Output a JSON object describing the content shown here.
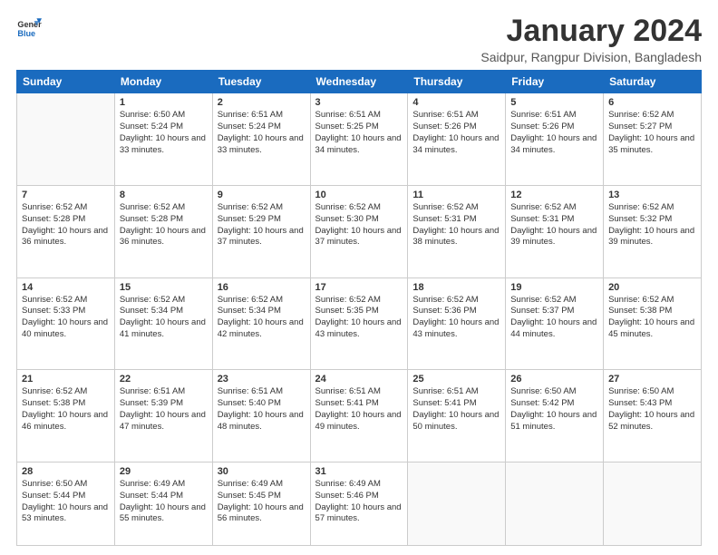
{
  "header": {
    "logo": "GeneralBlue",
    "month": "January 2024",
    "location": "Saidpur, Rangpur Division, Bangladesh"
  },
  "weekdays": [
    "Sunday",
    "Monday",
    "Tuesday",
    "Wednesday",
    "Thursday",
    "Friday",
    "Saturday"
  ],
  "weeks": [
    [
      {
        "day": "",
        "sunrise": "",
        "sunset": "",
        "daylight": ""
      },
      {
        "day": "1",
        "sunrise": "Sunrise: 6:50 AM",
        "sunset": "Sunset: 5:24 PM",
        "daylight": "Daylight: 10 hours and 33 minutes."
      },
      {
        "day": "2",
        "sunrise": "Sunrise: 6:51 AM",
        "sunset": "Sunset: 5:24 PM",
        "daylight": "Daylight: 10 hours and 33 minutes."
      },
      {
        "day": "3",
        "sunrise": "Sunrise: 6:51 AM",
        "sunset": "Sunset: 5:25 PM",
        "daylight": "Daylight: 10 hours and 34 minutes."
      },
      {
        "day": "4",
        "sunrise": "Sunrise: 6:51 AM",
        "sunset": "Sunset: 5:26 PM",
        "daylight": "Daylight: 10 hours and 34 minutes."
      },
      {
        "day": "5",
        "sunrise": "Sunrise: 6:51 AM",
        "sunset": "Sunset: 5:26 PM",
        "daylight": "Daylight: 10 hours and 34 minutes."
      },
      {
        "day": "6",
        "sunrise": "Sunrise: 6:52 AM",
        "sunset": "Sunset: 5:27 PM",
        "daylight": "Daylight: 10 hours and 35 minutes."
      }
    ],
    [
      {
        "day": "7",
        "sunrise": "Sunrise: 6:52 AM",
        "sunset": "Sunset: 5:28 PM",
        "daylight": "Daylight: 10 hours and 36 minutes."
      },
      {
        "day": "8",
        "sunrise": "Sunrise: 6:52 AM",
        "sunset": "Sunset: 5:28 PM",
        "daylight": "Daylight: 10 hours and 36 minutes."
      },
      {
        "day": "9",
        "sunrise": "Sunrise: 6:52 AM",
        "sunset": "Sunset: 5:29 PM",
        "daylight": "Daylight: 10 hours and 37 minutes."
      },
      {
        "day": "10",
        "sunrise": "Sunrise: 6:52 AM",
        "sunset": "Sunset: 5:30 PM",
        "daylight": "Daylight: 10 hours and 37 minutes."
      },
      {
        "day": "11",
        "sunrise": "Sunrise: 6:52 AM",
        "sunset": "Sunset: 5:31 PM",
        "daylight": "Daylight: 10 hours and 38 minutes."
      },
      {
        "day": "12",
        "sunrise": "Sunrise: 6:52 AM",
        "sunset": "Sunset: 5:31 PM",
        "daylight": "Daylight: 10 hours and 39 minutes."
      },
      {
        "day": "13",
        "sunrise": "Sunrise: 6:52 AM",
        "sunset": "Sunset: 5:32 PM",
        "daylight": "Daylight: 10 hours and 39 minutes."
      }
    ],
    [
      {
        "day": "14",
        "sunrise": "Sunrise: 6:52 AM",
        "sunset": "Sunset: 5:33 PM",
        "daylight": "Daylight: 10 hours and 40 minutes."
      },
      {
        "day": "15",
        "sunrise": "Sunrise: 6:52 AM",
        "sunset": "Sunset: 5:34 PM",
        "daylight": "Daylight: 10 hours and 41 minutes."
      },
      {
        "day": "16",
        "sunrise": "Sunrise: 6:52 AM",
        "sunset": "Sunset: 5:34 PM",
        "daylight": "Daylight: 10 hours and 42 minutes."
      },
      {
        "day": "17",
        "sunrise": "Sunrise: 6:52 AM",
        "sunset": "Sunset: 5:35 PM",
        "daylight": "Daylight: 10 hours and 43 minutes."
      },
      {
        "day": "18",
        "sunrise": "Sunrise: 6:52 AM",
        "sunset": "Sunset: 5:36 PM",
        "daylight": "Daylight: 10 hours and 43 minutes."
      },
      {
        "day": "19",
        "sunrise": "Sunrise: 6:52 AM",
        "sunset": "Sunset: 5:37 PM",
        "daylight": "Daylight: 10 hours and 44 minutes."
      },
      {
        "day": "20",
        "sunrise": "Sunrise: 6:52 AM",
        "sunset": "Sunset: 5:38 PM",
        "daylight": "Daylight: 10 hours and 45 minutes."
      }
    ],
    [
      {
        "day": "21",
        "sunrise": "Sunrise: 6:52 AM",
        "sunset": "Sunset: 5:38 PM",
        "daylight": "Daylight: 10 hours and 46 minutes."
      },
      {
        "day": "22",
        "sunrise": "Sunrise: 6:51 AM",
        "sunset": "Sunset: 5:39 PM",
        "daylight": "Daylight: 10 hours and 47 minutes."
      },
      {
        "day": "23",
        "sunrise": "Sunrise: 6:51 AM",
        "sunset": "Sunset: 5:40 PM",
        "daylight": "Daylight: 10 hours and 48 minutes."
      },
      {
        "day": "24",
        "sunrise": "Sunrise: 6:51 AM",
        "sunset": "Sunset: 5:41 PM",
        "daylight": "Daylight: 10 hours and 49 minutes."
      },
      {
        "day": "25",
        "sunrise": "Sunrise: 6:51 AM",
        "sunset": "Sunset: 5:41 PM",
        "daylight": "Daylight: 10 hours and 50 minutes."
      },
      {
        "day": "26",
        "sunrise": "Sunrise: 6:50 AM",
        "sunset": "Sunset: 5:42 PM",
        "daylight": "Daylight: 10 hours and 51 minutes."
      },
      {
        "day": "27",
        "sunrise": "Sunrise: 6:50 AM",
        "sunset": "Sunset: 5:43 PM",
        "daylight": "Daylight: 10 hours and 52 minutes."
      }
    ],
    [
      {
        "day": "28",
        "sunrise": "Sunrise: 6:50 AM",
        "sunset": "Sunset: 5:44 PM",
        "daylight": "Daylight: 10 hours and 53 minutes."
      },
      {
        "day": "29",
        "sunrise": "Sunrise: 6:49 AM",
        "sunset": "Sunset: 5:44 PM",
        "daylight": "Daylight: 10 hours and 55 minutes."
      },
      {
        "day": "30",
        "sunrise": "Sunrise: 6:49 AM",
        "sunset": "Sunset: 5:45 PM",
        "daylight": "Daylight: 10 hours and 56 minutes."
      },
      {
        "day": "31",
        "sunrise": "Sunrise: 6:49 AM",
        "sunset": "Sunset: 5:46 PM",
        "daylight": "Daylight: 10 hours and 57 minutes."
      },
      {
        "day": "",
        "sunrise": "",
        "sunset": "",
        "daylight": ""
      },
      {
        "day": "",
        "sunrise": "",
        "sunset": "",
        "daylight": ""
      },
      {
        "day": "",
        "sunrise": "",
        "sunset": "",
        "daylight": ""
      }
    ]
  ]
}
